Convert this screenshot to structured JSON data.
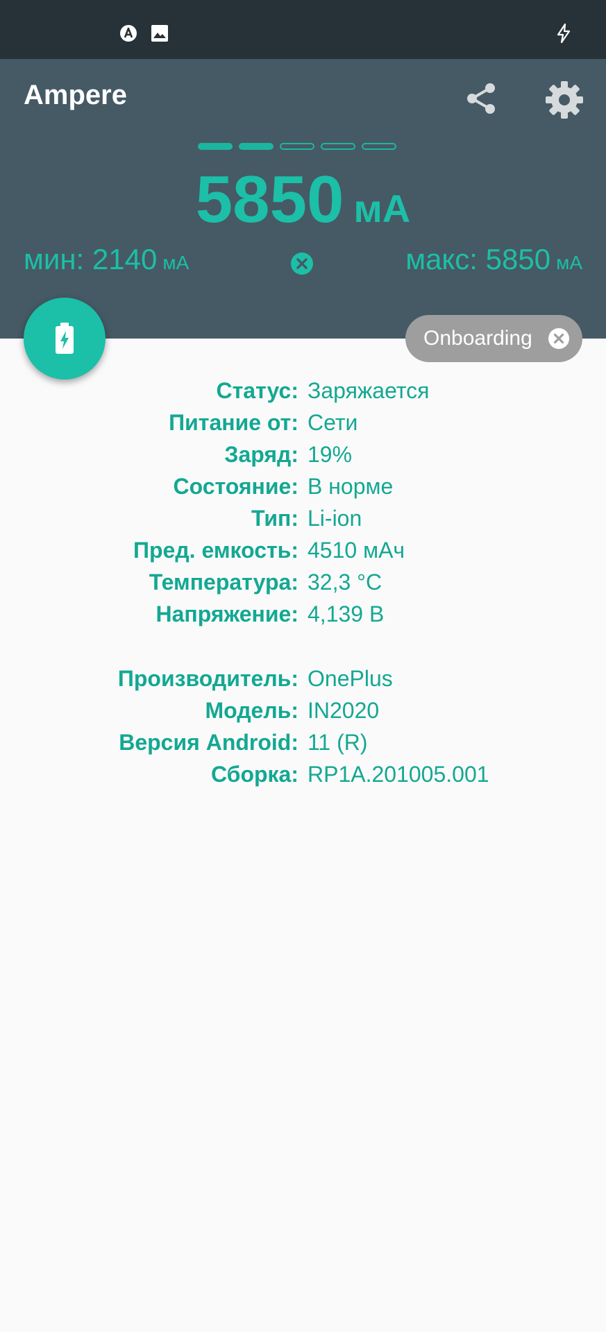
{
  "status_bar": {
    "icons": [
      "autostart-a-icon",
      "image-icon",
      "charging-bolt-icon"
    ]
  },
  "header": {
    "title": "Ampere",
    "pager": {
      "pages": 5,
      "active_count": 2
    },
    "current": {
      "value": "5850",
      "unit": "мА"
    },
    "min": {
      "label": "мин: 2140",
      "unit": "мА"
    },
    "max": {
      "label": "макс: 5850",
      "unit": "мА"
    }
  },
  "onboarding_chip": {
    "label": "Onboarding"
  },
  "battery_info": [
    {
      "label": "Статус:",
      "value": "Заряжается"
    },
    {
      "label": "Питание от:",
      "value": "Сети"
    },
    {
      "label": "Заряд:",
      "value": "19%"
    },
    {
      "label": "Состояние:",
      "value": "В норме"
    },
    {
      "label": "Тип:",
      "value": "Li-ion"
    },
    {
      "label": "Пред. емкость:",
      "value": "4510 мАч"
    },
    {
      "label": "Температура:",
      "value": "32,3 °C"
    },
    {
      "label": "Напряжение:",
      "value": "4,139 В"
    }
  ],
  "device_info": [
    {
      "label": "Производитель:",
      "value": "OnePlus"
    },
    {
      "label": "Модель:",
      "value": "IN2020"
    },
    {
      "label": "Версия Android:",
      "value": "11 (R)"
    },
    {
      "label": "Сборка:",
      "value": "RP1A.201005.001"
    }
  ],
  "colors": {
    "accent": "#1cbfa7",
    "label_text": "#13a893",
    "appbar": "#455a64",
    "statusbar": "#263238",
    "chip": "#9e9e9e"
  }
}
